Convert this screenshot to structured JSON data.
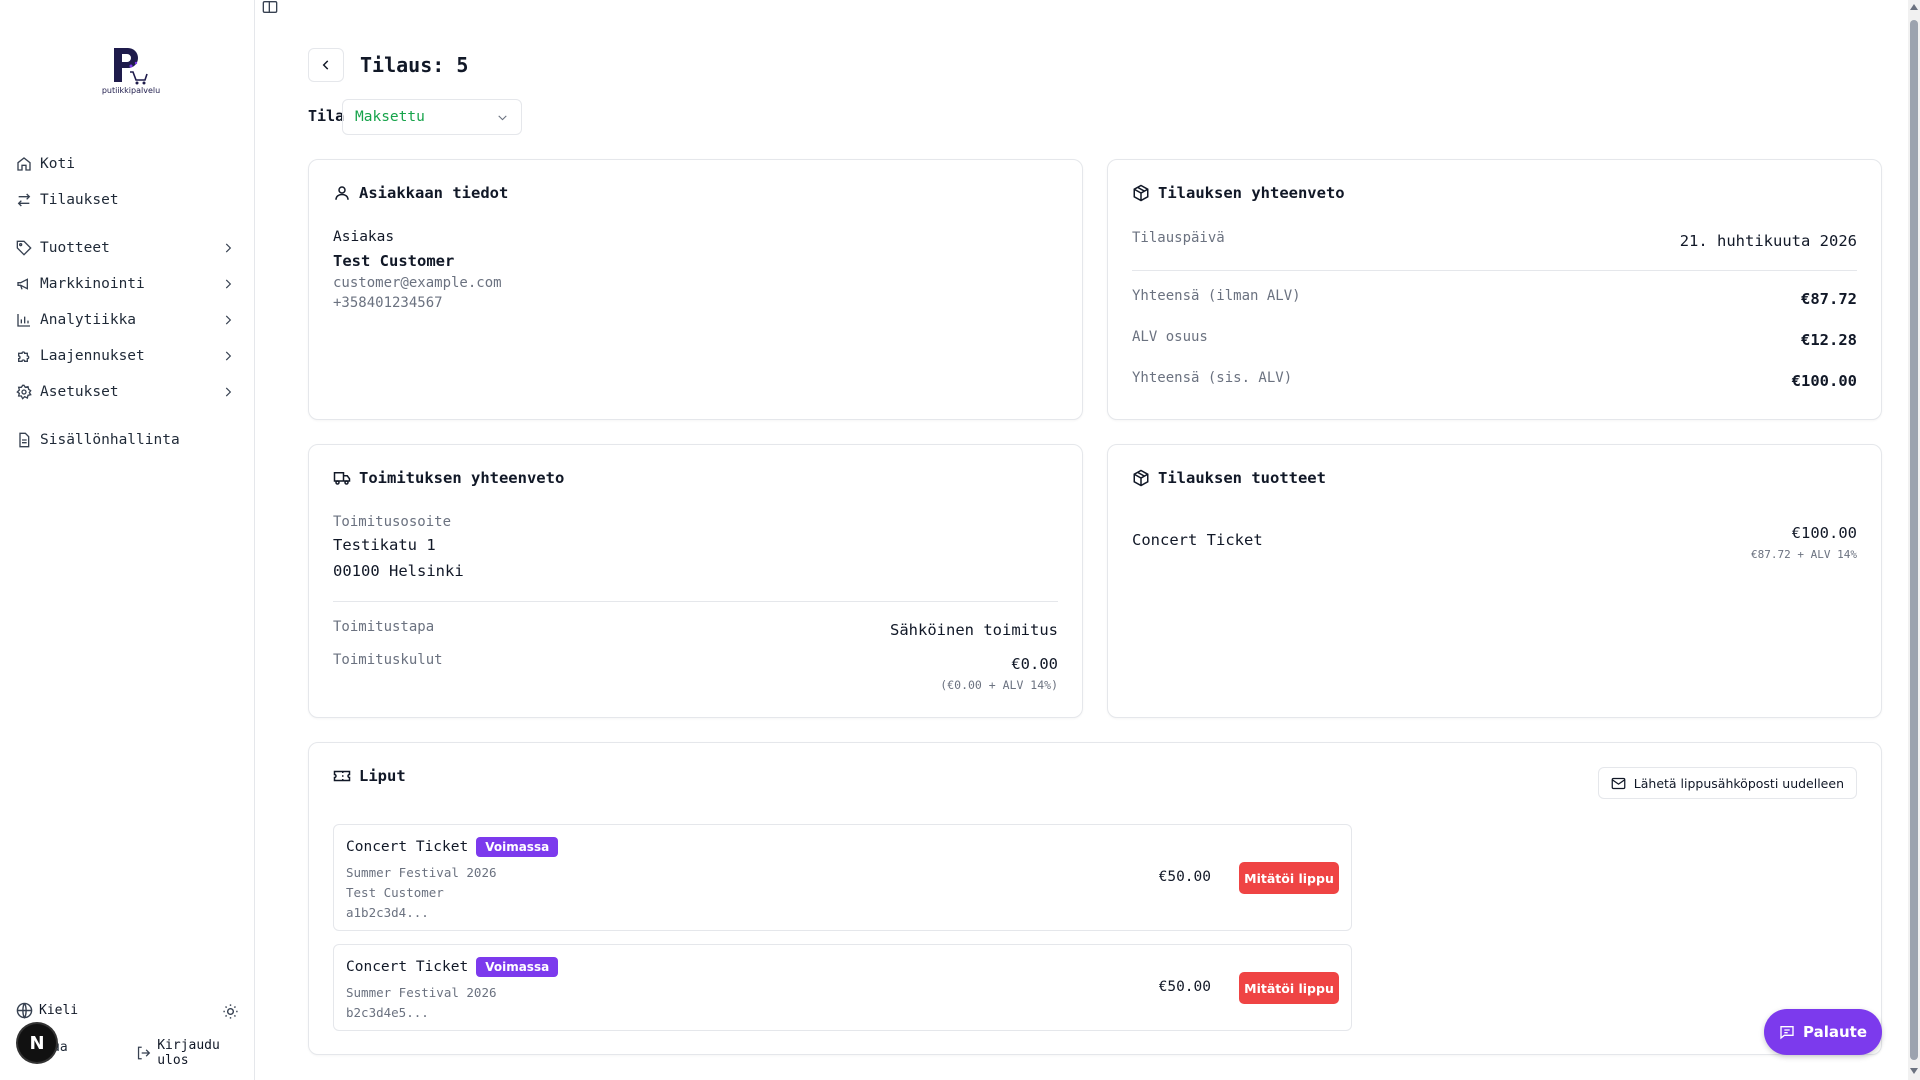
{
  "brand": {
    "logo_text": "putiikkipalvelu"
  },
  "sidebar": {
    "items": [
      {
        "label": "Koti",
        "icon": "home-icon"
      },
      {
        "label": "Tilaukset",
        "icon": "arrows-icon"
      },
      {
        "label": "Tuotteet",
        "icon": "tag-icon"
      },
      {
        "label": "Markkinointi",
        "icon": "megaphone-icon"
      },
      {
        "label": "Analytiikka",
        "icon": "bar-chart-icon"
      },
      {
        "label": "Laajennukset",
        "icon": "puzzle-icon"
      },
      {
        "label": "Asetukset",
        "icon": "gear-icon"
      },
      {
        "label": "Sisällönhallinta",
        "icon": "document-icon"
      }
    ],
    "language_label": "Kieli",
    "user_label": "ua",
    "logout_label": "Kirjaudu ulos",
    "avatar_letter": "N"
  },
  "header": {
    "title": "Tilaus: 5"
  },
  "status": {
    "label": "Tila",
    "value": "Maksettu"
  },
  "customer": {
    "title": "Asiakkaan tiedot",
    "label": "Asiakas",
    "name": "Test Customer",
    "email": "customer@example.com",
    "phone": "+358401234567"
  },
  "summary": {
    "title": "Tilauksen yhteenveto",
    "date_label": "Tilauspäivä",
    "date_value": "21. huhtikuuta 2026",
    "subtotal_label": "Yhteensä (ilman ALV)",
    "subtotal_value": "€87.72",
    "vat_label": "ALV osuus",
    "vat_value": "€12.28",
    "total_label": "Yhteensä (sis. ALV)",
    "total_value": "€100.00"
  },
  "shipping": {
    "title": "Toimituksen yhteenveto",
    "address_label": "Toimitusosoite",
    "address_line1": "Testikatu 1",
    "address_line2": "00100 Helsinki",
    "method_label": "Toimitustapa",
    "method_value": "Sähköinen toimitus",
    "cost_label": "Toimituskulut",
    "cost_value": "€0.00",
    "cost_detail": "(€0.00 + ALV 14%)"
  },
  "products": {
    "title": "Tilauksen tuotteet",
    "items": [
      {
        "name": "Concert Ticket",
        "price": "€100.00",
        "detail": "€87.72 + ALV 14%"
      }
    ]
  },
  "tickets": {
    "title": "Liput",
    "resend_label": "Lähetä lippusähköposti uudelleen",
    "items": [
      {
        "name": "Concert Ticket",
        "badge": "Voimassa",
        "event": "Summer Festival 2026",
        "holder": "Test Customer",
        "code": "a1b2c3d4...",
        "price": "€50.00",
        "action": "Mitätöi lippu"
      },
      {
        "name": "Concert Ticket",
        "badge": "Voimassa",
        "event": "Summer Festival 2026",
        "code": "b2c3d4e5...",
        "price": "€50.00",
        "action": "Mitätöi lippu"
      }
    ]
  },
  "feedback": {
    "label": "Palaute"
  },
  "colors": {
    "accent": "#7c3aed",
    "danger": "#ef4444",
    "success": "#16a34a"
  }
}
